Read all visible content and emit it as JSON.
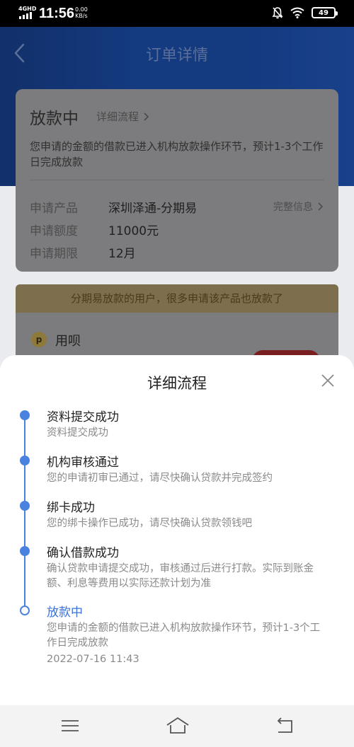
{
  "status_bar": {
    "network": "4GHD",
    "time": "11:56",
    "speed_value": "0.00",
    "speed_unit": "KB/s",
    "battery": "49"
  },
  "header": {
    "title": "订单详情",
    "back_icon": "chevron-left-icon"
  },
  "order_card": {
    "status": "放款中",
    "detail_link": "详细流程",
    "description": "您申请的金额的借款已进入机构放款操作环节，预计1-3个工作日完成放款",
    "full_info_link": "完整信息",
    "fields": [
      {
        "label": "申请产品",
        "value": "深圳泽通-分期易"
      },
      {
        "label": "申请额度",
        "value": "11000元"
      },
      {
        "label": "申请期限",
        "value": "12月"
      }
    ]
  },
  "promo": {
    "banner": "分期易放款的用户，很多申请该产品也放款了",
    "product_name": "用呗",
    "product_logo_char": "p"
  },
  "sheet": {
    "title": "详细流程",
    "close_icon": "close-icon",
    "steps": [
      {
        "title": "资料提交成功",
        "desc": "资料提交成功",
        "current": false
      },
      {
        "title": "机构审核通过",
        "desc": "您的申请初审已通过，请尽快确认贷款并完成签约",
        "current": false
      },
      {
        "title": "绑卡成功",
        "desc": "您的绑卡操作已成功，请尽快确认贷款领钱吧",
        "current": false
      },
      {
        "title": "确认借款成功",
        "desc": "确认贷款申请提交成功，审核通过后进行打款。实际到账金额、利息等费用以实际还款计划为准",
        "current": false
      },
      {
        "title": "放款中",
        "desc": "您申请的金额的借款已进入机构放款操作环节，预计1-3个工作日完成放款",
        "time": "2022-07-16 11:43",
        "current": true
      }
    ]
  },
  "nav_bar": {
    "menu_icon": "menu-icon",
    "home_icon": "home-icon",
    "back_icon": "back-icon"
  },
  "colors": {
    "accent": "#4a82e0",
    "header_blue": "#143a80"
  }
}
